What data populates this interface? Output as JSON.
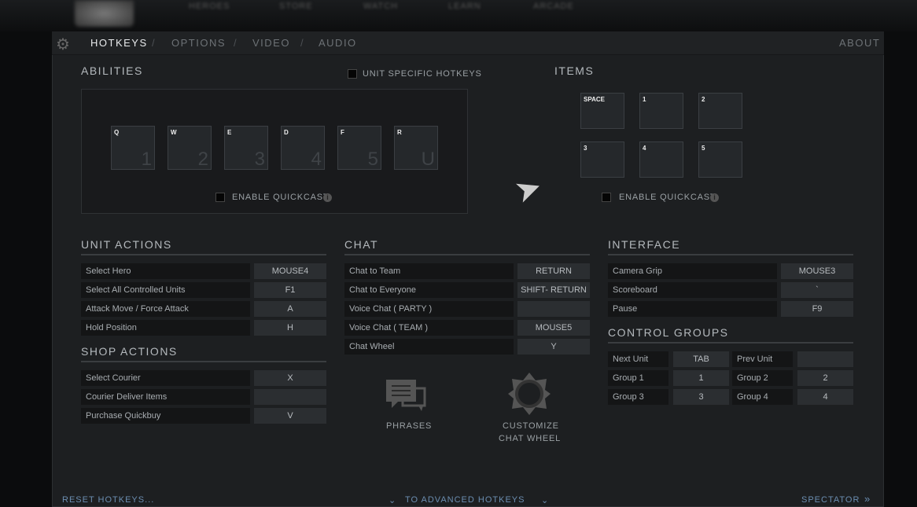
{
  "top_nav": [
    "HEROES",
    "STORE",
    "WATCH",
    "LEARN",
    "ARCADE"
  ],
  "tabs": [
    {
      "label": "HOTKEYS",
      "active": true
    },
    {
      "label": "OPTIONS"
    },
    {
      "label": "VIDEO"
    },
    {
      "label": "AUDIO"
    }
  ],
  "about": "ABOUT",
  "abilities": {
    "title": "ABILITIES",
    "unit_specific": "UNIT SPECIFIC HOTKEYS",
    "quickcast": "ENABLE QUICKCAST",
    "slots": [
      {
        "key": "Q",
        "num": "1"
      },
      {
        "key": "W",
        "num": "2"
      },
      {
        "key": "E",
        "num": "3"
      },
      {
        "key": "D",
        "num": "4"
      },
      {
        "key": "F",
        "num": "5"
      },
      {
        "key": "R",
        "num": "U"
      }
    ]
  },
  "items": {
    "title": "ITEMS",
    "quickcast": "ENABLE QUICKCAST",
    "slots": [
      "SPACE",
      "1",
      "2",
      "3",
      "4",
      "5"
    ]
  },
  "unit_actions": {
    "title": "UNIT ACTIONS",
    "rows": [
      {
        "label": "Select Hero",
        "key": "MOUSE4"
      },
      {
        "label": "Select All Controlled Units",
        "key": "F1"
      },
      {
        "label": "Attack Move / Force Attack",
        "key": "A"
      },
      {
        "label": "Hold Position",
        "key": "H"
      }
    ]
  },
  "shop_actions": {
    "title": "SHOP ACTIONS",
    "rows": [
      {
        "label": "Select Courier",
        "key": "X"
      },
      {
        "label": "Courier Deliver Items",
        "key": ""
      },
      {
        "label": "Purchase Quickbuy",
        "key": "V"
      }
    ]
  },
  "chat": {
    "title": "CHAT",
    "rows": [
      {
        "label": "Chat to Team",
        "key": "RETURN"
      },
      {
        "label": "Chat to Everyone",
        "key": "SHIFT- RETURN"
      },
      {
        "label": "Voice Chat ( PARTY )",
        "key": ""
      },
      {
        "label": "Voice Chat ( TEAM )",
        "key": "MOUSE5"
      },
      {
        "label": "Chat Wheel",
        "key": "Y"
      }
    ],
    "phrases": "PHRASES",
    "customize": "CUSTOMIZE",
    "chat_wheel": "CHAT WHEEL"
  },
  "interface": {
    "title": "INTERFACE",
    "rows": [
      {
        "label": "Camera Grip",
        "key": "MOUSE3"
      },
      {
        "label": "Scoreboard",
        "key": "`"
      },
      {
        "label": "Pause",
        "key": "F9"
      }
    ]
  },
  "control_groups": {
    "title": "CONTROL GROUPS",
    "rows": [
      [
        {
          "label": "Next Unit",
          "key": "TAB"
        },
        {
          "label": "Prev Unit",
          "key": ""
        }
      ],
      [
        {
          "label": "Group 1",
          "key": "1"
        },
        {
          "label": "Group 2",
          "key": "2"
        }
      ],
      [
        {
          "label": "Group 3",
          "key": "3"
        },
        {
          "label": "Group 4",
          "key": "4"
        }
      ]
    ]
  },
  "footer": {
    "reset": "RESET HOTKEYS...",
    "advanced": "TO ADVANCED HOTKEYS",
    "spectator": "SPECTATOR"
  },
  "colors": {
    "link": "#6b8db0",
    "panel": "#1d1f21"
  }
}
